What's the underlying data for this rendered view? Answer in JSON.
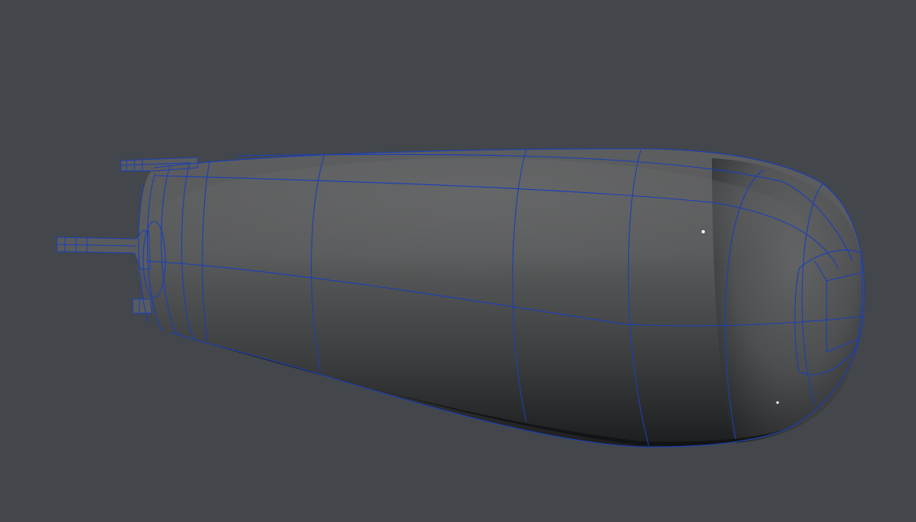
{
  "viewport": {
    "background_color": "#43474b",
    "wire_color": "#1a3fb8",
    "mesh_dark_color": "#1e1f20",
    "mesh_mid_color": "#4a4b4c",
    "mesh_light_color": "#6e6f70",
    "highlight_color": "#ffffff",
    "selected_object": "capsule-mesh",
    "display_mode": "smooth-shaded-with-wireframe"
  }
}
